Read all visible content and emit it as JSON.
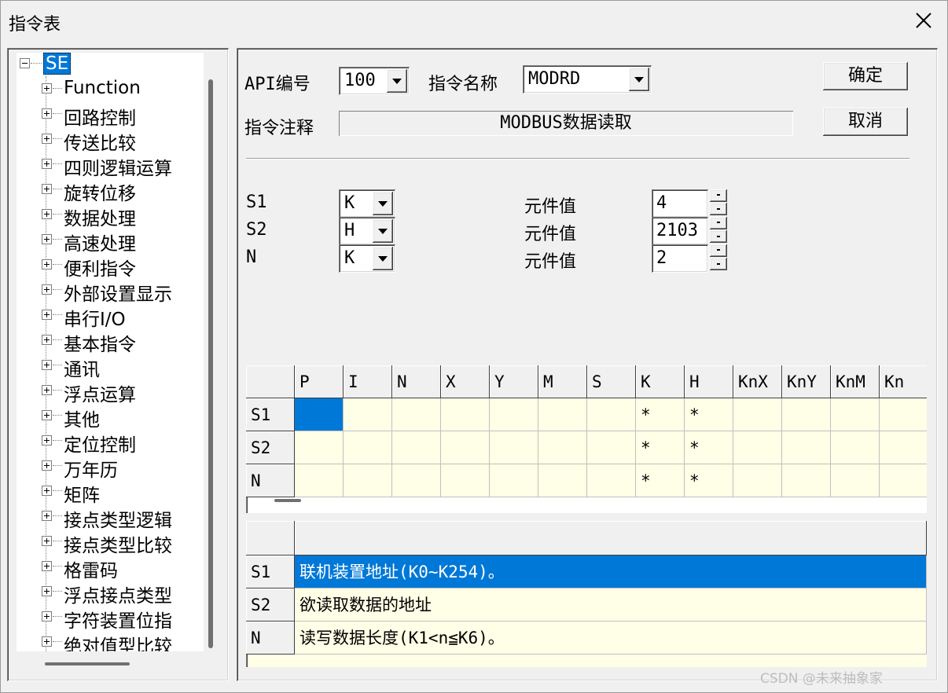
{
  "window": {
    "title": "指令表"
  },
  "tree": {
    "root": "SE",
    "items": [
      "Function",
      "回路控制",
      "传送比较",
      "四则逻辑运算",
      "旋转位移",
      "数据处理",
      "高速处理",
      "便利指令",
      "外部设置显示",
      "串行I/O",
      "基本指令",
      "通讯",
      "浮点运算",
      "其他",
      "定位控制",
      "万年历",
      "矩阵",
      "接点类型逻辑",
      "接点类型比较",
      "格雷码",
      "浮点接点类型",
      "字符装置位指",
      "绝对值型比较"
    ]
  },
  "form": {
    "api_label": "API编号",
    "api_value": "100",
    "name_label": "指令名称",
    "name_value": "MODRD",
    "comment_label": "指令注释",
    "comment_value": "MODBUS数据读取",
    "ok_label": "确定",
    "cancel_label": "取消"
  },
  "operands": [
    {
      "name": "S1",
      "type": "K",
      "value_label": "元件值",
      "value": "4"
    },
    {
      "name": "S2",
      "type": "H",
      "value_label": "元件值",
      "value": "2103"
    },
    {
      "name": "N",
      "type": "K",
      "value_label": "元件值",
      "value": "2"
    }
  ],
  "device_table": {
    "columns": [
      "P",
      "I",
      "N",
      "X",
      "Y",
      "M",
      "S",
      "K",
      "H",
      "KnX",
      "KnY",
      "KnM",
      "Kn"
    ],
    "rows": [
      {
        "label": "S1",
        "cells": [
          "",
          "",
          "",
          "",
          "",
          "",
          "",
          "*",
          "*",
          "",
          "",
          "",
          ""
        ]
      },
      {
        "label": "S2",
        "cells": [
          "",
          "",
          "",
          "",
          "",
          "",
          "",
          "*",
          "*",
          "",
          "",
          "",
          ""
        ]
      },
      {
        "label": "N",
        "cells": [
          "",
          "",
          "",
          "",
          "",
          "",
          "",
          "*",
          "*",
          "",
          "",
          "",
          ""
        ]
      }
    ]
  },
  "desc_table": {
    "rows": [
      {
        "label": "S1",
        "text": "联机装置地址(K0~K254)。"
      },
      {
        "label": "S2",
        "text": "欲读取数据的地址"
      },
      {
        "label": "N",
        "text": "读写数据长度(K1<n≦K6)。"
      }
    ]
  },
  "watermark": "CSDN @未来抽象家",
  "colors": {
    "selection": "#0078d7",
    "cell_bg": "#fffee6",
    "face": "#f0f0f0"
  }
}
